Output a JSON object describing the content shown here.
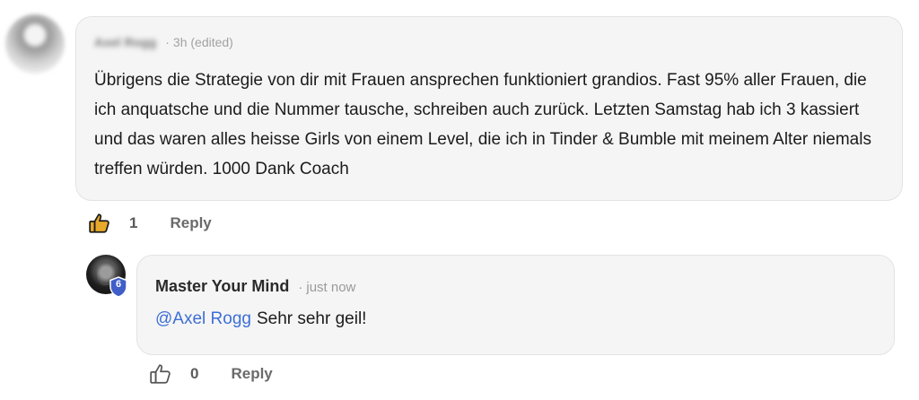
{
  "comment": {
    "author": "Axel Rogg",
    "time": "3h",
    "edited": "(edited)",
    "text": "Übrigens die Strategie von dir mit Frauen ansprechen funktioniert grandios. Fast 95% aller Frauen, die ich anquatsche und die Nummer tausche, schreiben auch zurück. Letzten Samstag hab ich 3 kassiert und das waren alles heisse Girls von einem Level, die ich in Tinder & Bumble mit meinem Alter niemals treffen würden. 1000 Dank Coach",
    "like_count": "1",
    "reply_label": "Reply",
    "like_icon": "thumbs-up-filled-icon",
    "like_color": "#e8a92b"
  },
  "reply": {
    "author": "Master Your Mind",
    "time": "just now",
    "mention": "@Axel Rogg",
    "text": "Sehr sehr geil!",
    "like_count": "0",
    "reply_label": "Reply",
    "badge_level": "6",
    "badge_color": "#3f5ec8",
    "mention_color": "#3d6fd6",
    "like_icon": "thumbs-up-outline-icon"
  }
}
